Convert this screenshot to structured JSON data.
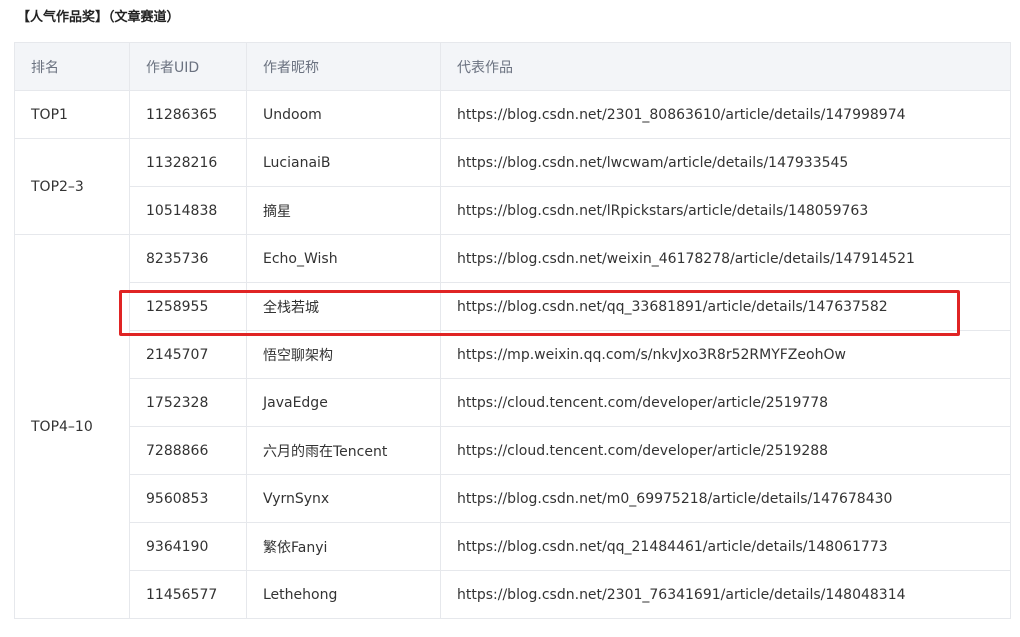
{
  "section_title": "【人气作品奖】（文章赛道）",
  "highlight_color": "#e02424",
  "table": {
    "headers": {
      "rank": "排名",
      "uid": "作者UID",
      "nickname": "作者昵称",
      "work": "代表作品"
    },
    "groups": {
      "top1": "TOP1",
      "top2_3": "TOP2–3",
      "top4_10": "TOP4–10"
    },
    "rows": [
      {
        "uid": "11286365",
        "nickname": "Undoom",
        "work": "https://blog.csdn.net/2301_80863610/article/details/147998974"
      },
      {
        "uid": "11328216",
        "nickname": "LucianaiB",
        "work": "https://blog.csdn.net/lwcwam/article/details/147933545"
      },
      {
        "uid": "10514838",
        "nickname": "摘星",
        "work": "https://blog.csdn.net/lRpickstars/article/details/148059763"
      },
      {
        "uid": "8235736",
        "nickname": "Echo_Wish",
        "work": "https://blog.csdn.net/weixin_46178278/article/details/147914521"
      },
      {
        "uid": "1258955",
        "nickname": "全栈若城",
        "work": "https://blog.csdn.net/qq_33681891/article/details/147637582"
      },
      {
        "uid": "2145707",
        "nickname": "悟空聊架构",
        "work": "https://mp.weixin.qq.com/s/nkvJxo3R8r52RMYFZeohOw"
      },
      {
        "uid": "1752328",
        "nickname": "JavaEdge",
        "work": "https://cloud.tencent.com/developer/article/2519778"
      },
      {
        "uid": "7288866",
        "nickname": "六月的雨在Tencent",
        "work": "https://cloud.tencent.com/developer/article/2519288"
      },
      {
        "uid": "9560853",
        "nickname": "VyrnSynx",
        "work": "https://blog.csdn.net/m0_69975218/article/details/147678430"
      },
      {
        "uid": "9364190",
        "nickname": "繁依Fanyi",
        "work": "https://blog.csdn.net/qq_21484461/article/details/148061773"
      },
      {
        "uid": "11456577",
        "nickname": "Lethehong",
        "work": "https://blog.csdn.net/2301_76341691/article/details/148048314"
      }
    ]
  }
}
